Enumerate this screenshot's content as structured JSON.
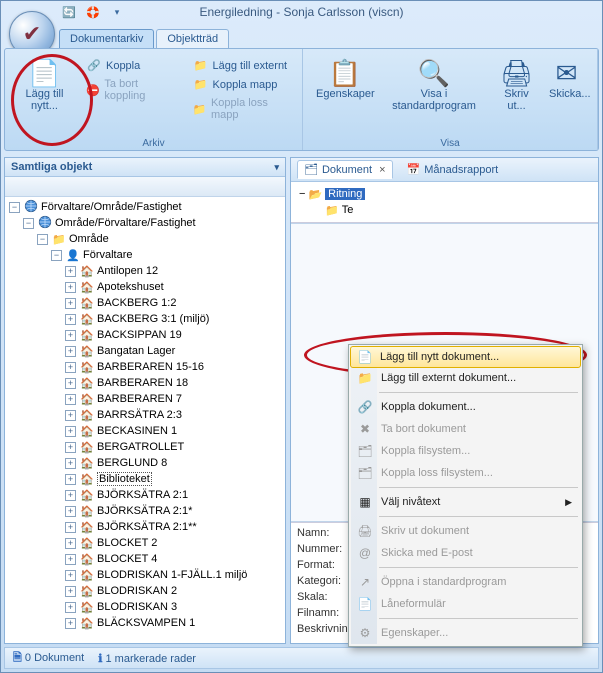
{
  "window": {
    "title": "Energiledning - Sonja Carlsson (viscn)"
  },
  "tabs": {
    "active": "Dokumentarkiv",
    "other": "Objektträd"
  },
  "ribbon": {
    "group_arkiv": "Arkiv",
    "group_visa": "Visa",
    "add_new": "Lägg till nytt...",
    "koppla": "Koppla",
    "ta_bort_koppling": "Ta bort koppling",
    "lagg_till_externt": "Lägg till externt",
    "koppla_mapp": "Koppla mapp",
    "koppla_loss_mapp": "Koppla loss mapp",
    "egenskaper": "Egenskaper",
    "visa_std": "Visa i standardprogram",
    "skriv_ut": "Skriv ut...",
    "skicka": "Skicka..."
  },
  "left_pane": {
    "title": "Samtliga objekt",
    "root": "Förvaltare/Område/Fastighet",
    "l1": "Område/Förvaltare/Fastighet",
    "l2": "Område",
    "l3": "Förvaltare",
    "items": [
      "Antilopen 12",
      "Apotekshuset",
      "BACKBERG 1:2",
      "BACKBERG 3:1 (miljö)",
      "BACKSIPPAN 19",
      "Bangatan Lager",
      "BARBERAREN 15-16",
      "BARBERAREN 18",
      "BARBERAREN 7",
      "BARRSÄTRA 2:3",
      "BECKASINEN 1",
      "BERGATROLLET",
      "BERGLUND 8",
      "Biblioteket",
      "BJÖRKSÄTRA 2:1",
      "BJÖRKSÄTRA 2:1*",
      "BJÖRKSÄTRA 2:1**",
      "BLOCKET 2",
      "BLOCKET 4",
      "BLODRISKAN 1-FJÄLL.1   miljö",
      "BLODRISKAN 2",
      "BLODRISKAN 3",
      "BLÄCKSVAMPEN 1"
    ],
    "selected_index": 13
  },
  "right_pane": {
    "tab_dokument": "Dokument",
    "tab_manadsrapport": "Månadsrapport",
    "folder_sel": "Ritning",
    "folder_other": "Te",
    "props": {
      "namn": "Namn:",
      "nummer": "Nummer:",
      "format": "Format:",
      "kategori": "Kategori:",
      "skala": "Skala:",
      "filnamn": "Filnamn:",
      "beskrivning": "Beskrivning"
    }
  },
  "context_menu": {
    "items": [
      {
        "label": "Lägg till nytt dokument...",
        "enabled": true,
        "hover": true
      },
      {
        "label": "Lägg till externt dokument...",
        "enabled": true
      },
      {
        "sep": true
      },
      {
        "label": "Koppla dokument...",
        "enabled": true
      },
      {
        "label": "Ta bort dokument",
        "enabled": false
      },
      {
        "label": "Koppla filsystem...",
        "enabled": false
      },
      {
        "label": "Koppla loss filsystem...",
        "enabled": false
      },
      {
        "sep": true
      },
      {
        "label": "Välj nivåtext",
        "enabled": true,
        "submenu": true
      },
      {
        "sep": true
      },
      {
        "label": "Skriv ut dokument",
        "enabled": false
      },
      {
        "label": "Skicka med E-post",
        "enabled": false
      },
      {
        "sep": true
      },
      {
        "label": "Öppna i standardprogram",
        "enabled": false
      },
      {
        "label": "Låneformulär",
        "enabled": false
      },
      {
        "sep": true
      },
      {
        "label": "Egenskaper...",
        "enabled": false
      }
    ]
  },
  "status": {
    "docs_count": "0 Dokument",
    "sel_rows": "1 markerade rader"
  }
}
